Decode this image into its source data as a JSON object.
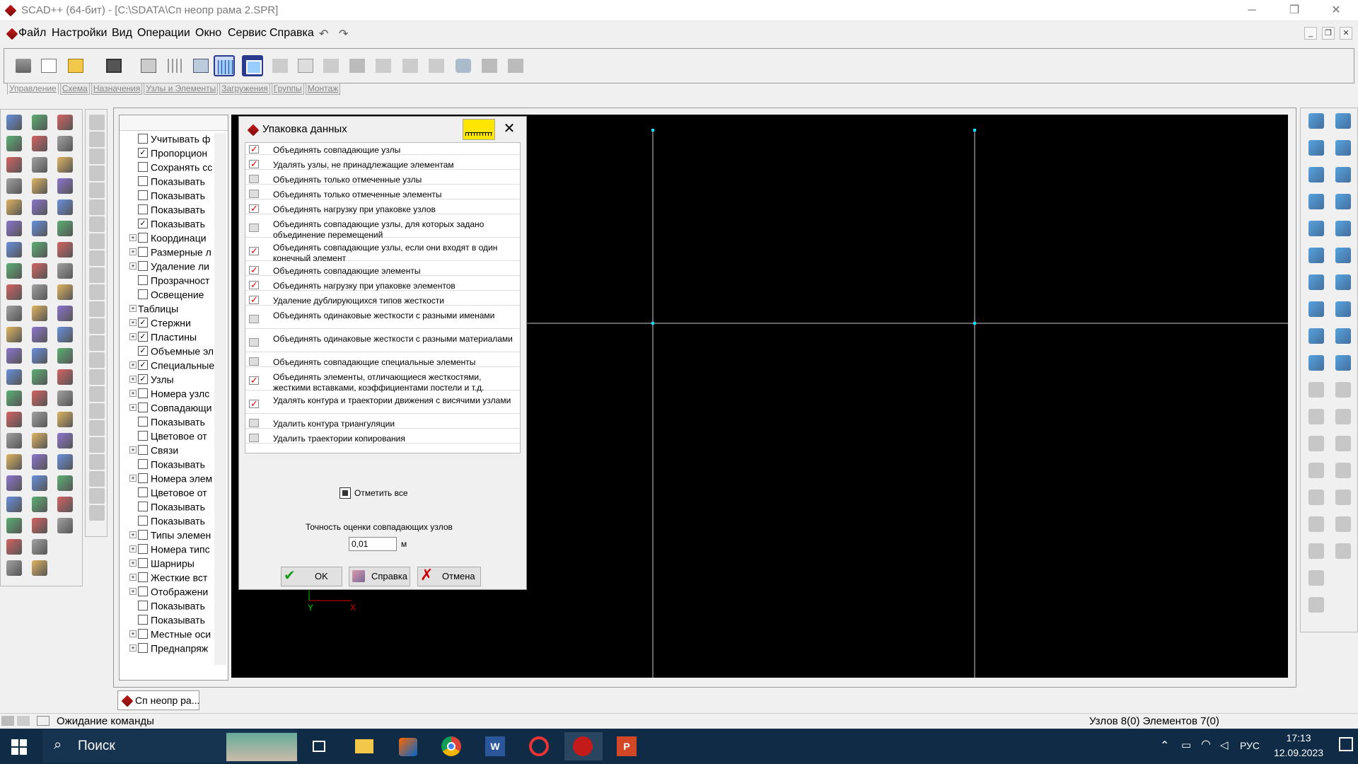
{
  "window": {
    "title": "SCAD++ (64-бит) - [C:\\SDATA\\Сп неопр рама 2.SPR]",
    "minimize": "─",
    "restore": "❐",
    "close": "✕"
  },
  "menu": {
    "items": [
      "Файл",
      "Настройки",
      "Вид",
      "Операции",
      "Окно",
      "Сервис",
      "Справка"
    ],
    "undo_icon": "undo-icon",
    "redo_icon": "redo-icon"
  },
  "tabs": [
    "Управление",
    "Схема",
    "Назначения",
    "Узлы и Элементы",
    "Загружения",
    "Группы",
    "Монтаж"
  ],
  "tree": {
    "rows": [
      {
        "label": "Учитывать ф",
        "check": false,
        "plus": false
      },
      {
        "label": "Пропорцион",
        "check": true,
        "plus": false
      },
      {
        "label": "Сохранять сс",
        "check": false,
        "plus": false
      },
      {
        "label": "Показывать",
        "check": false,
        "plus": false
      },
      {
        "label": "Показывать",
        "check": false,
        "plus": false
      },
      {
        "label": "Показывать",
        "check": false,
        "plus": false
      },
      {
        "label": "Показывать",
        "check": true,
        "plus": false
      },
      {
        "label": "Координаци",
        "check": false,
        "plus": true
      },
      {
        "label": "Размерные л",
        "check": false,
        "plus": true
      },
      {
        "label": "Удаление ли",
        "check": false,
        "plus": true
      },
      {
        "label": "Прозрачност",
        "check": false,
        "plus": false
      },
      {
        "label": "Освещение",
        "check": false,
        "plus": false
      },
      {
        "label": "Таблицы",
        "check": null,
        "plus": true
      },
      {
        "label": "Стержни",
        "check": true,
        "plus": true
      },
      {
        "label": "Пластины",
        "check": true,
        "plus": true
      },
      {
        "label": "Объемные эл",
        "check": true,
        "plus": false
      },
      {
        "label": "Специальные",
        "check": true,
        "plus": true
      },
      {
        "label": "Узлы",
        "check": true,
        "plus": true
      },
      {
        "label": "Номера узлс",
        "check": false,
        "plus": true
      },
      {
        "label": "Совпадающи",
        "check": false,
        "plus": true
      },
      {
        "label": "Показывать",
        "check": false,
        "plus": false
      },
      {
        "label": "Цветовое от",
        "check": false,
        "plus": false
      },
      {
        "label": "Связи",
        "check": false,
        "plus": true
      },
      {
        "label": "Показывать",
        "check": false,
        "plus": false
      },
      {
        "label": "Номера элем",
        "check": false,
        "plus": true
      },
      {
        "label": "Цветовое от",
        "check": false,
        "plus": false
      },
      {
        "label": "Показывать",
        "check": false,
        "plus": false
      },
      {
        "label": "Показывать",
        "check": false,
        "plus": false
      },
      {
        "label": "Типы элемен",
        "check": false,
        "plus": true
      },
      {
        "label": "Номера типс",
        "check": false,
        "plus": true
      },
      {
        "label": "Шарниры",
        "check": false,
        "plus": true
      },
      {
        "label": "Жесткие вст",
        "check": false,
        "plus": true
      },
      {
        "label": "Отображени",
        "check": false,
        "plus": true
      },
      {
        "label": "Показывать",
        "check": false,
        "plus": false
      },
      {
        "label": "Показывать",
        "check": false,
        "plus": false
      },
      {
        "label": "Местные оси",
        "check": false,
        "plus": true
      },
      {
        "label": "Преднапряж",
        "check": false,
        "plus": true
      }
    ]
  },
  "axes": {
    "y": "Y",
    "x": "X"
  },
  "dialog": {
    "title": "Упаковка данных",
    "options": [
      {
        "label": "Объединять совпадающие узлы",
        "checked": true
      },
      {
        "label": "Удалять узлы, не принадлежащие элементам",
        "checked": true
      },
      {
        "label": "Объединять только отмеченные узлы",
        "checked": false
      },
      {
        "label": "Объединять только отмеченные элементы",
        "checked": false
      },
      {
        "label": "Объединять нагрузку при упаковке узлов",
        "checked": true
      },
      {
        "label": "Объединять совпадающие узлы, для которых задано объединение перемещений",
        "checked": false
      },
      {
        "label": "Объединять совпадающие узлы, если они входят в один конечный элемент",
        "checked": true
      },
      {
        "label": "Объединять совпадающие элементы",
        "checked": true
      },
      {
        "label": "Объединять нагрузку при упаковке элементов",
        "checked": true
      },
      {
        "label": "Удаление дублирующихся типов жесткости",
        "checked": true
      },
      {
        "label": "Объединять одинаковые жесткости с разными именами",
        "checked": false
      },
      {
        "label": "Объединять одинаковые жесткости с разными материалами",
        "checked": false
      },
      {
        "label": "Объединять совпадающие специальные элементы",
        "checked": false
      },
      {
        "label": "Объединять элементы, отличающиеся жесткостями, жесткими вставками, коэффициентами постели и т.д.",
        "checked": true
      },
      {
        "label": "Удалять контура и траектории движения с висячими узлами",
        "checked": true
      },
      {
        "label": "Удалить контура триангуляции",
        "checked": false
      },
      {
        "label": "Удалить траектории копирования",
        "checked": false
      }
    ],
    "select_all": "Отметить все",
    "precision_label": "Точность оценки совпадающих узлов",
    "precision_value": "0,01",
    "precision_unit": "м",
    "ok": "OK",
    "help": "Справка",
    "cancel": "Отмена"
  },
  "doc_tab": "Сп неопр ра...",
  "status": {
    "left": "Ожидание команды",
    "right": "Узлов 8(0) Элементов 7(0)"
  },
  "taskbar": {
    "search": "Поиск",
    "lang": "РУС",
    "time": "17:13",
    "date": "12.09.2023"
  }
}
